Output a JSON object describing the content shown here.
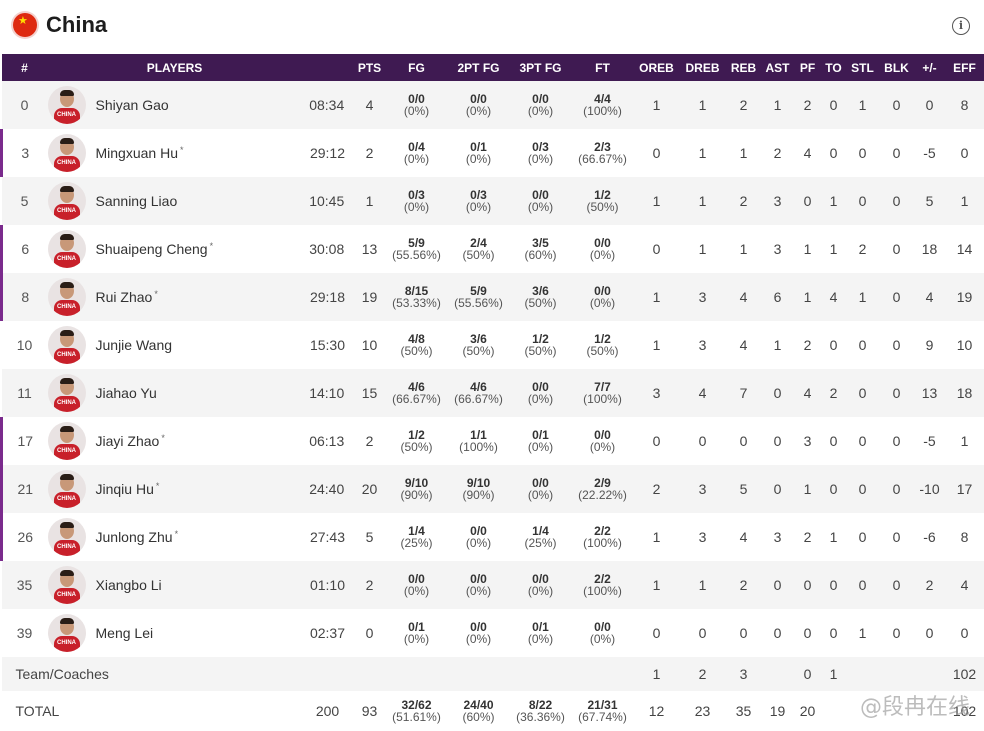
{
  "team": {
    "name": "China"
  },
  "columns": [
    "#",
    "PLAYERS",
    "",
    "PTS",
    "FG",
    "2PT FG",
    "3PT FG",
    "FT",
    "OREB",
    "DREB",
    "REB",
    "AST",
    "PF",
    "TO",
    "STL",
    "BLK",
    "+/-",
    "EFF"
  ],
  "players": [
    {
      "num": "0",
      "name": "Shiyan Gao",
      "starter": false,
      "min": "08:34",
      "pts": "4",
      "fg": "0/0",
      "fg_pct": "(0%)",
      "p2": "0/0",
      "p2_pct": "(0%)",
      "p3": "0/0",
      "p3_pct": "(0%)",
      "ft": "4/4",
      "ft_pct": "(100%)",
      "oreb": "1",
      "dreb": "1",
      "reb": "2",
      "ast": "1",
      "pf": "2",
      "to": "0",
      "stl": "1",
      "blk": "0",
      "pm": "0",
      "eff": "8"
    },
    {
      "num": "3",
      "name": "Mingxuan Hu",
      "starter": true,
      "min": "29:12",
      "pts": "2",
      "fg": "0/4",
      "fg_pct": "(0%)",
      "p2": "0/1",
      "p2_pct": "(0%)",
      "p3": "0/3",
      "p3_pct": "(0%)",
      "ft": "2/3",
      "ft_pct": "(66.67%)",
      "oreb": "0",
      "dreb": "1",
      "reb": "1",
      "ast": "2",
      "pf": "4",
      "to": "0",
      "stl": "0",
      "blk": "0",
      "pm": "-5",
      "eff": "0"
    },
    {
      "num": "5",
      "name": "Sanning Liao",
      "starter": false,
      "min": "10:45",
      "pts": "1",
      "fg": "0/3",
      "fg_pct": "(0%)",
      "p2": "0/3",
      "p2_pct": "(0%)",
      "p3": "0/0",
      "p3_pct": "(0%)",
      "ft": "1/2",
      "ft_pct": "(50%)",
      "oreb": "1",
      "dreb": "1",
      "reb": "2",
      "ast": "3",
      "pf": "0",
      "to": "1",
      "stl": "0",
      "blk": "0",
      "pm": "5",
      "eff": "1"
    },
    {
      "num": "6",
      "name": "Shuaipeng Cheng",
      "starter": true,
      "min": "30:08",
      "pts": "13",
      "fg": "5/9",
      "fg_pct": "(55.56%)",
      "p2": "2/4",
      "p2_pct": "(50%)",
      "p3": "3/5",
      "p3_pct": "(60%)",
      "ft": "0/0",
      "ft_pct": "(0%)",
      "oreb": "0",
      "dreb": "1",
      "reb": "1",
      "ast": "3",
      "pf": "1",
      "to": "1",
      "stl": "2",
      "blk": "0",
      "pm": "18",
      "eff": "14"
    },
    {
      "num": "8",
      "name": "Rui Zhao",
      "starter": true,
      "min": "29:18",
      "pts": "19",
      "fg": "8/15",
      "fg_pct": "(53.33%)",
      "p2": "5/9",
      "p2_pct": "(55.56%)",
      "p3": "3/6",
      "p3_pct": "(50%)",
      "ft": "0/0",
      "ft_pct": "(0%)",
      "oreb": "1",
      "dreb": "3",
      "reb": "4",
      "ast": "6",
      "pf": "1",
      "to": "4",
      "stl": "1",
      "blk": "0",
      "pm": "4",
      "eff": "19"
    },
    {
      "num": "10",
      "name": "Junjie Wang",
      "starter": false,
      "min": "15:30",
      "pts": "10",
      "fg": "4/8",
      "fg_pct": "(50%)",
      "p2": "3/6",
      "p2_pct": "(50%)",
      "p3": "1/2",
      "p3_pct": "(50%)",
      "ft": "1/2",
      "ft_pct": "(50%)",
      "oreb": "1",
      "dreb": "3",
      "reb": "4",
      "ast": "1",
      "pf": "2",
      "to": "0",
      "stl": "0",
      "blk": "0",
      "pm": "9",
      "eff": "10"
    },
    {
      "num": "11",
      "name": "Jiahao Yu",
      "starter": false,
      "min": "14:10",
      "pts": "15",
      "fg": "4/6",
      "fg_pct": "(66.67%)",
      "p2": "4/6",
      "p2_pct": "(66.67%)",
      "p3": "0/0",
      "p3_pct": "(0%)",
      "ft": "7/7",
      "ft_pct": "(100%)",
      "oreb": "3",
      "dreb": "4",
      "reb": "7",
      "ast": "0",
      "pf": "4",
      "to": "2",
      "stl": "0",
      "blk": "0",
      "pm": "13",
      "eff": "18"
    },
    {
      "num": "17",
      "name": "Jiayi Zhao",
      "starter": true,
      "min": "06:13",
      "pts": "2",
      "fg": "1/2",
      "fg_pct": "(50%)",
      "p2": "1/1",
      "p2_pct": "(100%)",
      "p3": "0/1",
      "p3_pct": "(0%)",
      "ft": "0/0",
      "ft_pct": "(0%)",
      "oreb": "0",
      "dreb": "0",
      "reb": "0",
      "ast": "0",
      "pf": "3",
      "to": "0",
      "stl": "0",
      "blk": "0",
      "pm": "-5",
      "eff": "1"
    },
    {
      "num": "21",
      "name": "Jinqiu Hu",
      "starter": true,
      "min": "24:40",
      "pts": "20",
      "fg": "9/10",
      "fg_pct": "(90%)",
      "p2": "9/10",
      "p2_pct": "(90%)",
      "p3": "0/0",
      "p3_pct": "(0%)",
      "ft": "2/9",
      "ft_pct": "(22.22%)",
      "oreb": "2",
      "dreb": "3",
      "reb": "5",
      "ast": "0",
      "pf": "1",
      "to": "0",
      "stl": "0",
      "blk": "0",
      "pm": "-10",
      "eff": "17"
    },
    {
      "num": "26",
      "name": "Junlong Zhu",
      "starter": true,
      "min": "27:43",
      "pts": "5",
      "fg": "1/4",
      "fg_pct": "(25%)",
      "p2": "0/0",
      "p2_pct": "(0%)",
      "p3": "1/4",
      "p3_pct": "(25%)",
      "ft": "2/2",
      "ft_pct": "(100%)",
      "oreb": "1",
      "dreb": "3",
      "reb": "4",
      "ast": "3",
      "pf": "2",
      "to": "1",
      "stl": "0",
      "blk": "0",
      "pm": "-6",
      "eff": "8"
    },
    {
      "num": "35",
      "name": "Xiangbo Li",
      "starter": false,
      "min": "01:10",
      "pts": "2",
      "fg": "0/0",
      "fg_pct": "(0%)",
      "p2": "0/0",
      "p2_pct": "(0%)",
      "p3": "0/0",
      "p3_pct": "(0%)",
      "ft": "2/2",
      "ft_pct": "(100%)",
      "oreb": "1",
      "dreb": "1",
      "reb": "2",
      "ast": "0",
      "pf": "0",
      "to": "0",
      "stl": "0",
      "blk": "0",
      "pm": "2",
      "eff": "4"
    },
    {
      "num": "39",
      "name": "Meng Lei",
      "starter": false,
      "min": "02:37",
      "pts": "0",
      "fg": "0/1",
      "fg_pct": "(0%)",
      "p2": "0/0",
      "p2_pct": "(0%)",
      "p3": "0/1",
      "p3_pct": "(0%)",
      "ft": "0/0",
      "ft_pct": "(0%)",
      "oreb": "0",
      "dreb": "0",
      "reb": "0",
      "ast": "0",
      "pf": "0",
      "to": "0",
      "stl": "1",
      "blk": "0",
      "pm": "0",
      "eff": "0"
    }
  ],
  "team_row": {
    "label": "Team/Coaches",
    "oreb": "1",
    "dreb": "2",
    "reb": "3",
    "ast": "",
    "pf": "0",
    "to": "1",
    "stl": "",
    "blk": "",
    "pm": "",
    "eff": "102"
  },
  "total_row": {
    "label": "TOTAL",
    "min": "200",
    "pts": "93",
    "fg": "32/62",
    "fg_pct": "(51.61%)",
    "p2": "24/40",
    "p2_pct": "(60%)",
    "p3": "8/22",
    "p3_pct": "(36.36%)",
    "ft": "21/31",
    "ft_pct": "(67.74%)",
    "oreb": "12",
    "dreb": "23",
    "reb": "35",
    "ast": "19",
    "pf": "20",
    "to": "",
    "stl": "",
    "blk": "",
    "pm": "",
    "eff": "102"
  },
  "watermark": "@段冉在线",
  "jersey_text": "CHINA",
  "starter_symbol": "*",
  "info_symbol": "i"
}
